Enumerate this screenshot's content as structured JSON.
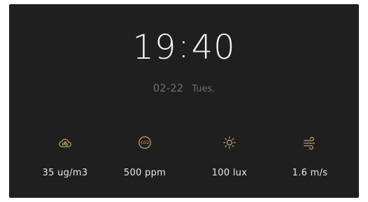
{
  "clock": {
    "hours": "19",
    "separator": ":",
    "minutes": "40",
    "date": "02-22",
    "weekday": "Tues."
  },
  "accent_color": "#c9a66b",
  "sensors": [
    {
      "icon": "cloud-particles-icon",
      "value": "35 ug/m3"
    },
    {
      "icon": "co2-icon",
      "icon_text": "CO2",
      "value": "500 ppm"
    },
    {
      "icon": "sun-icon",
      "value": "100 lux"
    },
    {
      "icon": "wind-icon",
      "value": "1.6 m/s"
    }
  ]
}
